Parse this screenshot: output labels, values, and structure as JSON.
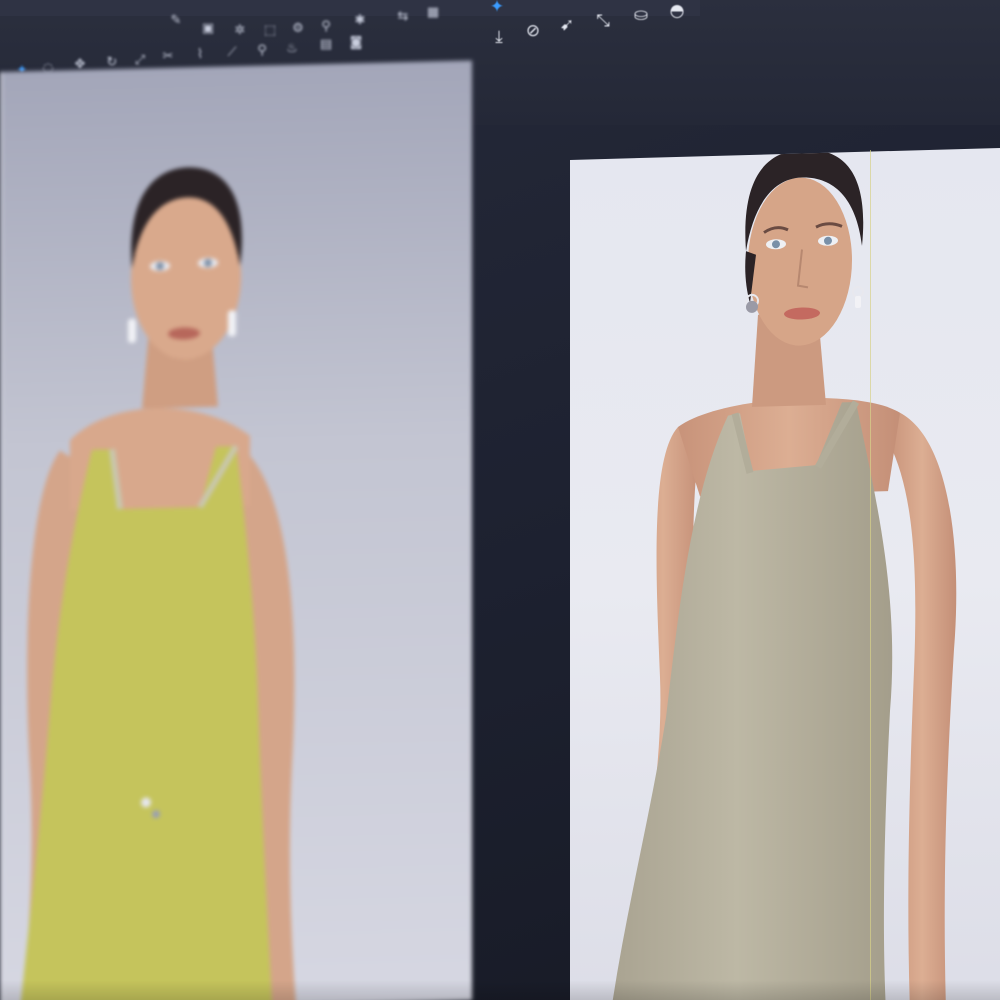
{
  "window": {
    "tabs": [
      "",
      "",
      "",
      "",
      "",
      ""
    ],
    "tab_title": ""
  },
  "toolbar": {
    "row1_icons": [
      "brush-icon",
      "box-icon",
      "bulb-icon",
      "dashed-box-icon",
      "gear-icon",
      "pin-icon",
      "spray-icon",
      "shuffle-icon",
      "grid-icon"
    ],
    "row2_icons": [
      "select-icon",
      "lasso-icon",
      "move-icon",
      "rotate-icon",
      "scale-icon",
      "cut-icon",
      "sew-icon",
      "fold-icon",
      "pin-icon",
      "steam-icon",
      "fabric-icon",
      "camera-icon",
      "light-icon",
      "measure-icon"
    ],
    "row3_icons": [
      "layer-icon",
      "puff-icon",
      "flip-icon",
      "arrange-icon",
      "drape-icon",
      "tack-icon",
      "gravity-icon",
      "sphere-icon",
      "mirror-icon",
      "collision-icon"
    ],
    "right_icons": [
      "transform-icon",
      "globe-icon",
      "magnet-icon",
      "resize-arrows-icon",
      "cylinder-icon",
      "dome-icon",
      "arrow-down-icon"
    ]
  },
  "viewports": {
    "left": {
      "avatar": "avatar-left",
      "garment_color": "#c5c45c",
      "background": "#c3c5d2"
    },
    "right": {
      "avatar": "avatar-right",
      "garment_color": "#b7b29f",
      "background": "#e5e7f0"
    }
  },
  "colors": {
    "ui_dark": "#1d2130",
    "accent": "#3b9cff",
    "skin": "#d9a98c",
    "hair": "#2b2326"
  }
}
